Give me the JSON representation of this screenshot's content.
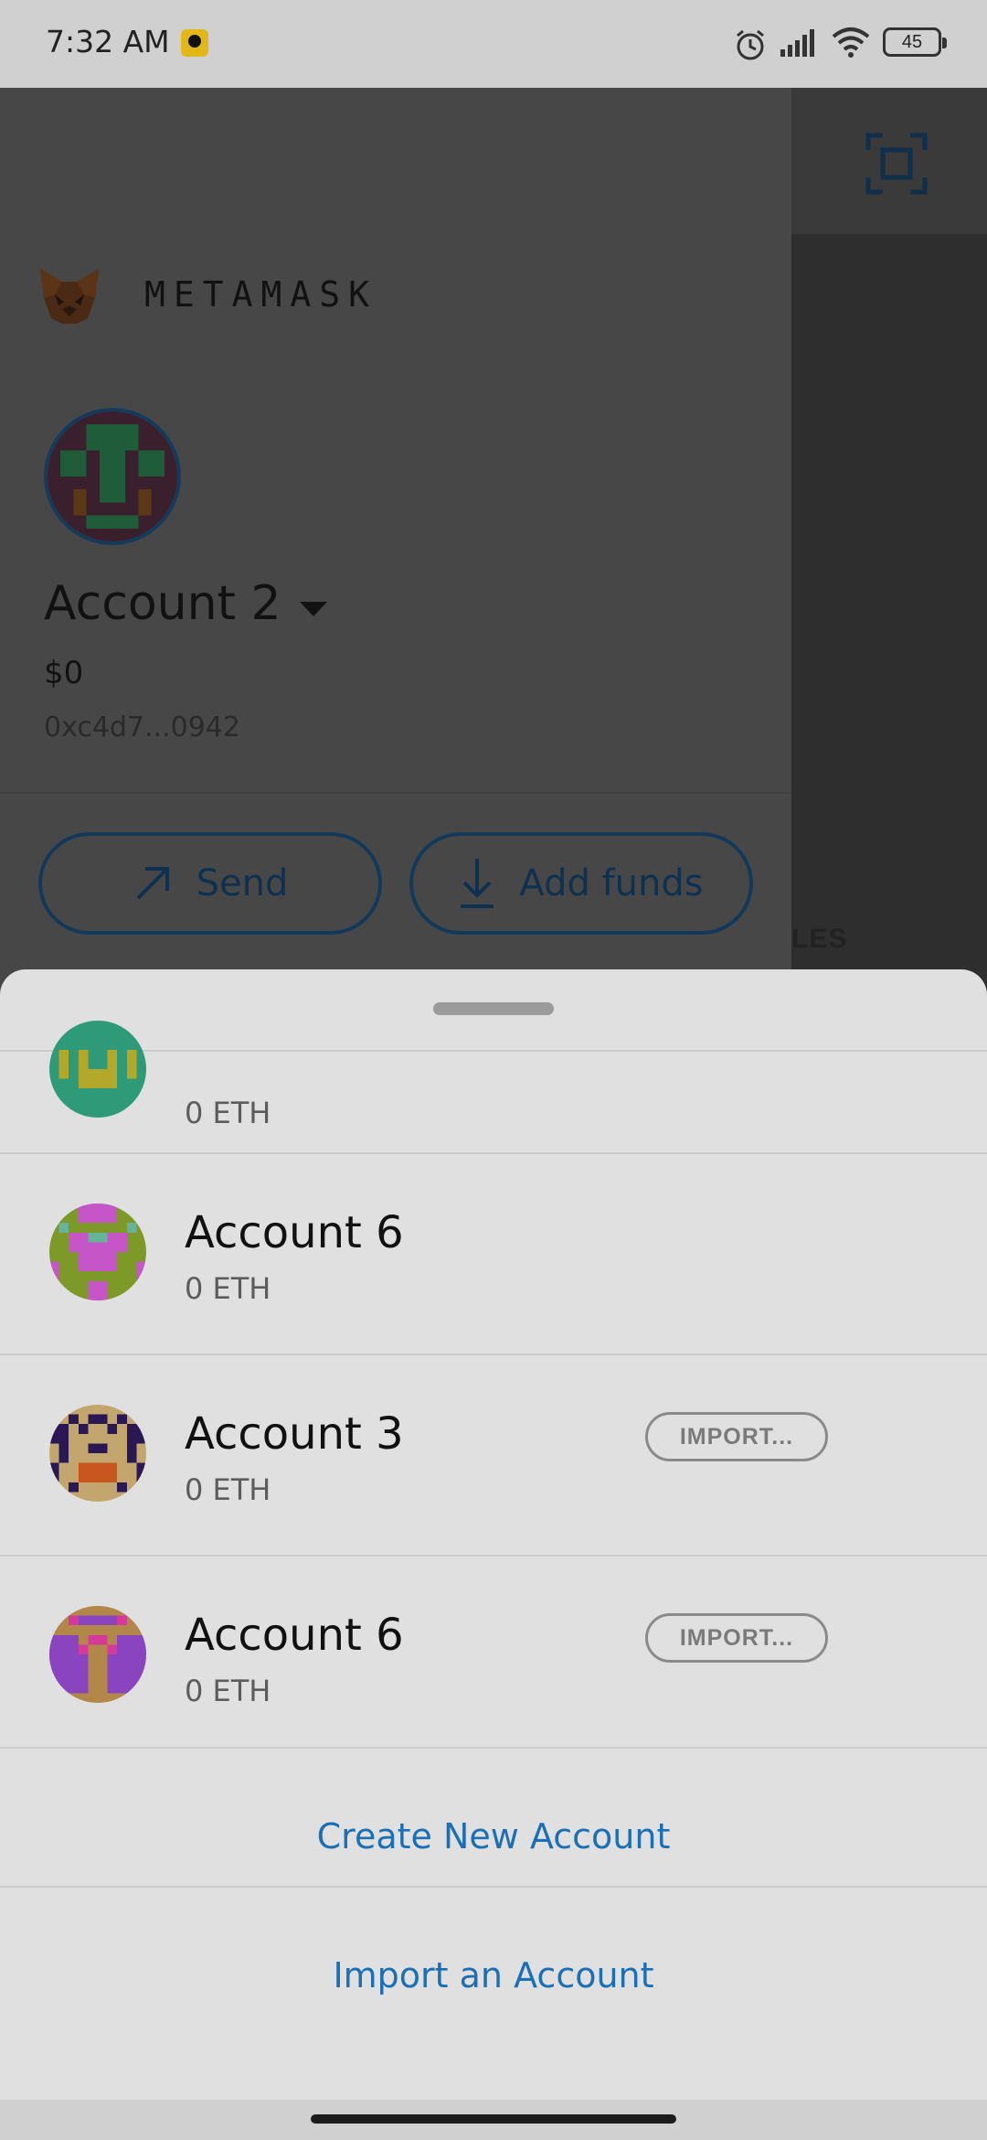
{
  "status_bar": {
    "time": "7:32 AM",
    "battery": "45",
    "icons": [
      "app-notification-icon",
      "alarm-icon",
      "signal-icon",
      "wifi-icon",
      "battery-icon"
    ]
  },
  "background_wallet": {
    "brand": "METAMASK",
    "account_name": "Account 2",
    "balance": "$0",
    "address": "0xc4d7...0942",
    "send_label": "Send",
    "add_funds_label": "Add funds",
    "partial_tab_text": "LES"
  },
  "account_sheet": {
    "accounts": [
      {
        "name": "",
        "balance": "0 ETH",
        "imported": false
      },
      {
        "name": "Account 6",
        "balance": "0 ETH",
        "imported": false
      },
      {
        "name": "Account 3",
        "balance": "0 ETH",
        "imported": true,
        "badge": "IMPORT..."
      },
      {
        "name": "Account 6",
        "balance": "0 ETH",
        "imported": true,
        "badge": "IMPORT..."
      }
    ],
    "create_label": "Create New Account",
    "import_label": "Import an Account"
  },
  "colors": {
    "link": "#1a6fb5",
    "button_outline": "#13395a",
    "sheet_background": "#e0e0e0"
  }
}
